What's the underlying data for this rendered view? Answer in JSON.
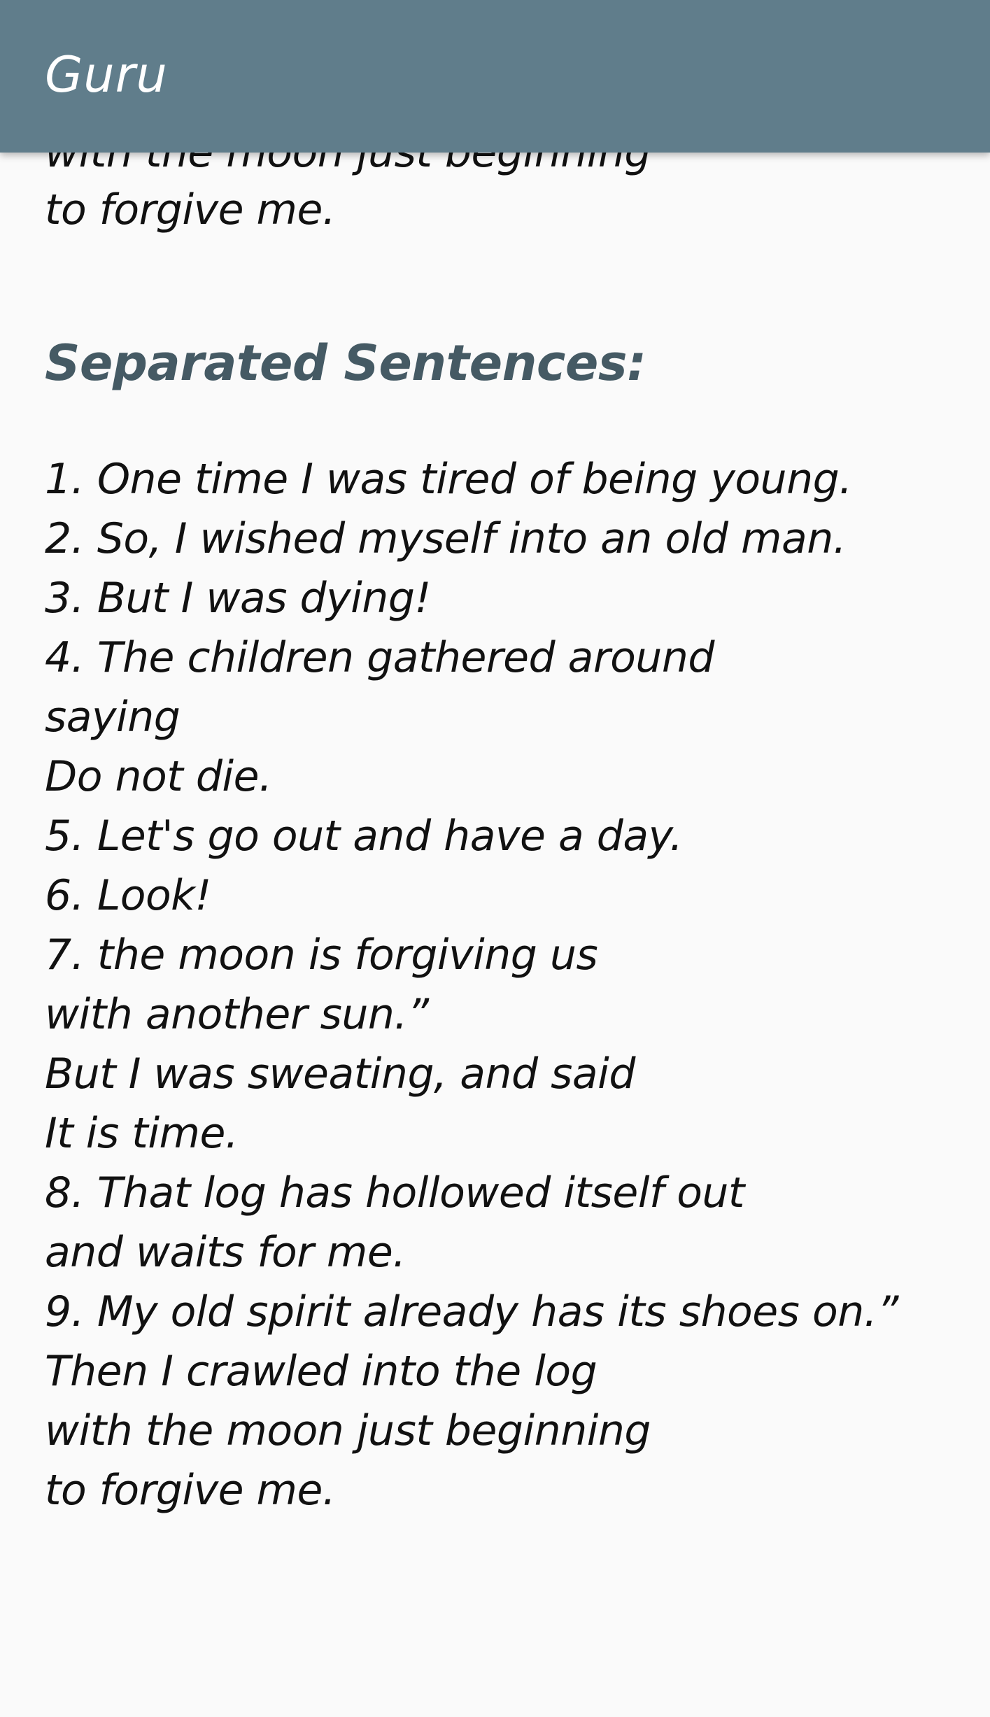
{
  "app_bar": {
    "title": "Guru"
  },
  "previous_text": {
    "clipped_line": "with the moon just beginning",
    "last_line": "to forgive me."
  },
  "section": {
    "title": "Separated Sentences:"
  },
  "sentences": [
    "1. One time I was tired of being young.",
    "2. So, I wished myself into an old man.",
    "3. But I was dying!",
    "4. The children gathered around",
    "saying",
    "Do not die.",
    "5. Let's go out and have a day.",
    "6. Look!",
    "7. the moon is forgiving us",
    "with another sun.”",
    "But I was sweating, and said",
    "It is time.",
    "8. That log has hollowed itself out",
    "and waits for me.",
    "9. My old spirit already has its shoes on.”",
    "Then I crawled into the log",
    "with the moon just beginning",
    "to forgive me."
  ],
  "colors": {
    "app_bar": "#607d8b",
    "section_title": "#455a64",
    "background": "#fafafa"
  }
}
